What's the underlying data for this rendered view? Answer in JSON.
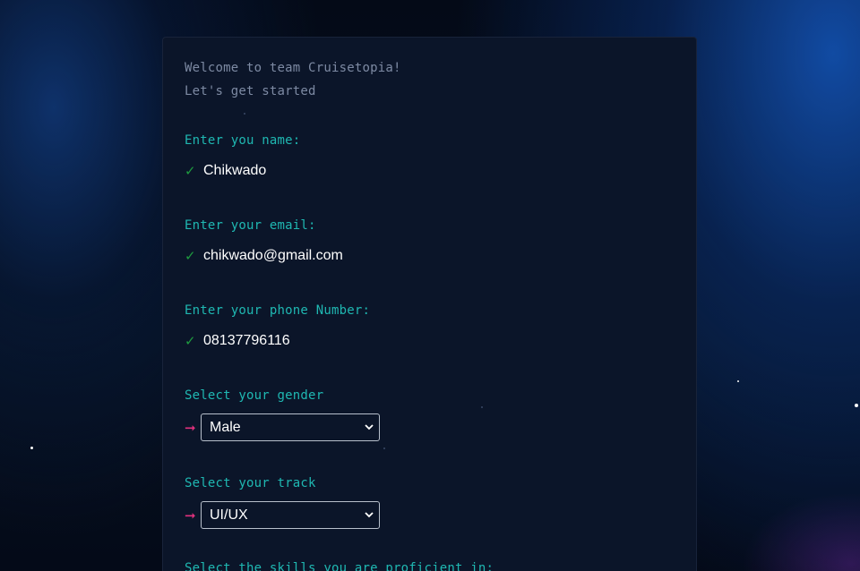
{
  "form": {
    "intro_line_1": "Welcome to team Cruisetopia!",
    "intro_line_2": "Let's get started",
    "name_label": "Enter you name:",
    "name_value": "Chikwado",
    "email_label": "Enter your email:",
    "email_value": "chikwado@gmail.com",
    "phone_label": "Enter your phone Number:",
    "phone_value": "08137796116",
    "gender_label": "Select your gender",
    "gender_selected": "Male",
    "track_label": "Select your track",
    "track_selected": "UI/UX",
    "skills_label": "Select the skills you are proficient in:",
    "check_glyph": "✓",
    "arrow_glyph": "➞"
  },
  "colors": {
    "background": "#050d1c",
    "card": "#0b1529",
    "label": "#1fb8b2",
    "intro": "#7d8aa3",
    "check": "#1e9a3f",
    "arrow": "#e0317d",
    "value": "#ffffff"
  },
  "icons": {
    "check": "check-icon",
    "arrow": "arrow-right-icon",
    "select": "chevron-down-icon"
  }
}
